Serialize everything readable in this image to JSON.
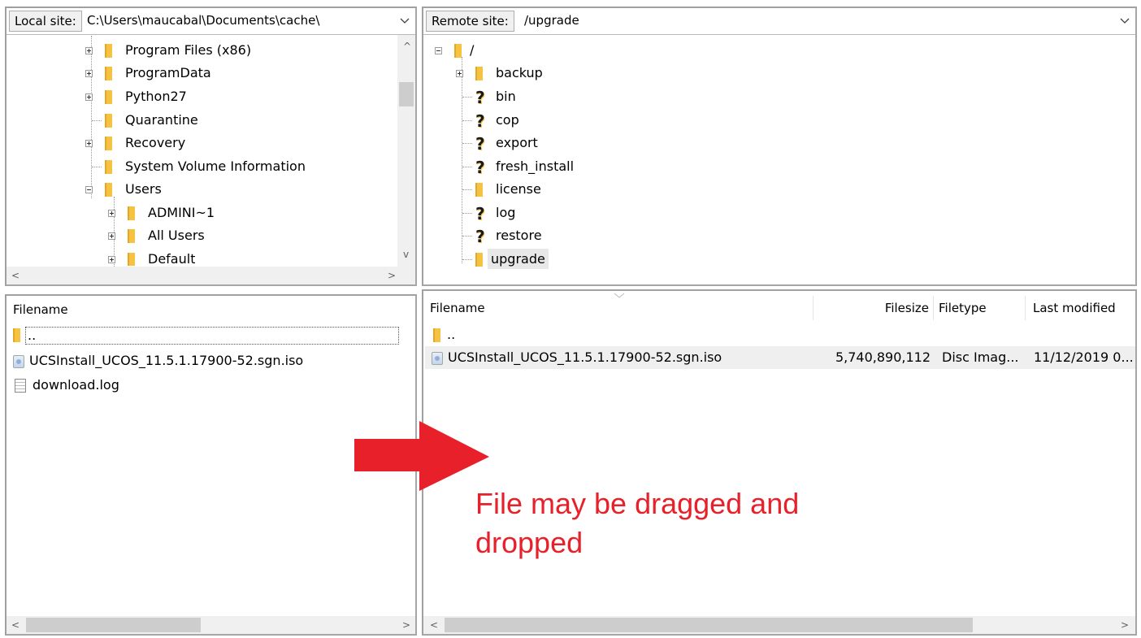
{
  "local": {
    "site_label": "Local site:",
    "path": "C:\\Users\\maucabal\\Documents\\cache\\",
    "tree": [
      {
        "label": "Program Files (x86)",
        "expander": "plus",
        "level": 1
      },
      {
        "label": "ProgramData",
        "expander": "plus",
        "level": 1
      },
      {
        "label": "Python27",
        "expander": "plus",
        "level": 1
      },
      {
        "label": "Quarantine",
        "expander": "none",
        "level": 1
      },
      {
        "label": "Recovery",
        "expander": "plus",
        "level": 1
      },
      {
        "label": "System Volume Information",
        "expander": "none",
        "level": 1
      },
      {
        "label": "Users",
        "expander": "minus",
        "level": 1
      },
      {
        "label": "ADMINI~1",
        "expander": "plus",
        "level": 2
      },
      {
        "label": "All Users",
        "expander": "plus",
        "level": 2
      },
      {
        "label": "Default",
        "expander": "plus",
        "level": 2
      }
    ],
    "files_header": "Filename",
    "files": [
      {
        "name": "..",
        "icon": "folder-icon"
      },
      {
        "name": "UCSInstall_UCOS_11.5.1.17900-52.sgn.iso",
        "icon": "disc-image-icon"
      },
      {
        "name": "download.log",
        "icon": "text-file-icon"
      }
    ]
  },
  "remote": {
    "site_label": "Remote site:",
    "path": "/upgrade",
    "tree_root": "/",
    "tree": [
      {
        "label": "backup",
        "icon": "folder-icon",
        "expander": "plus"
      },
      {
        "label": "bin",
        "icon": "unknown-folder-icon",
        "expander": "none"
      },
      {
        "label": "cop",
        "icon": "unknown-folder-icon",
        "expander": "none"
      },
      {
        "label": "export",
        "icon": "unknown-folder-icon",
        "expander": "none"
      },
      {
        "label": "fresh_install",
        "icon": "unknown-folder-icon",
        "expander": "none"
      },
      {
        "label": "license",
        "icon": "folder-icon",
        "expander": "none"
      },
      {
        "label": "log",
        "icon": "unknown-folder-icon",
        "expander": "none"
      },
      {
        "label": "restore",
        "icon": "unknown-folder-icon",
        "expander": "none"
      },
      {
        "label": "upgrade",
        "icon": "folder-icon",
        "expander": "none",
        "selected": true
      }
    ],
    "columns": {
      "filename": "Filename",
      "filesize": "Filesize",
      "filetype": "Filetype",
      "modified": "Last modified"
    },
    "files": [
      {
        "name": "..",
        "icon": "folder-icon",
        "size": "",
        "type": "",
        "modified": ""
      },
      {
        "name": "UCSInstall_UCOS_11.5.1.17900-52.sgn.iso",
        "icon": "disc-image-icon",
        "size": "5,740,890,112",
        "type": "Disc Imag...",
        "modified": "11/12/2019 0..."
      }
    ]
  },
  "annotation": {
    "text_line1": "File may be dragged and",
    "text_line2": "dropped",
    "color": "#e8202a"
  },
  "scrollbar_glyphs": {
    "up": "^",
    "down": "v",
    "left": "<",
    "right": ">"
  }
}
